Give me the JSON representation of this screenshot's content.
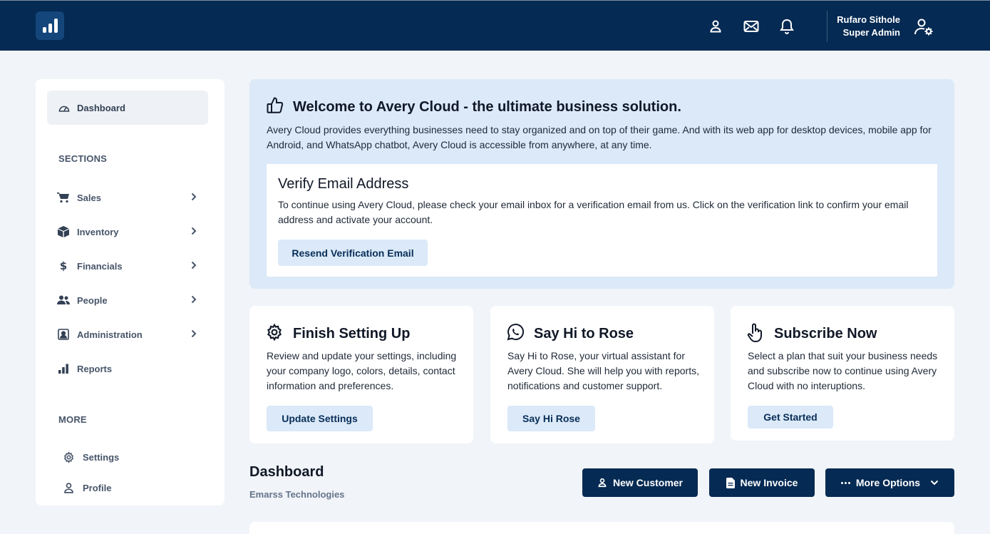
{
  "header": {
    "user_name": "Rufaro Sithole",
    "user_role": "Super Admin"
  },
  "sidebar": {
    "active_item": "Dashboard",
    "sections_heading": "SECTIONS",
    "items": [
      {
        "label": "Sales",
        "icon": "cart-icon"
      },
      {
        "label": "Inventory",
        "icon": "box-icon"
      },
      {
        "label": "Financials",
        "icon": "dollar-icon"
      },
      {
        "label": "People",
        "icon": "users-icon"
      },
      {
        "label": "Administration",
        "icon": "id-badge-icon"
      },
      {
        "label": "Reports",
        "icon": "bar-chart-icon"
      }
    ],
    "more_heading": "MORE",
    "more_items": [
      {
        "label": "Settings",
        "icon": "gear-icon"
      },
      {
        "label": "Profile",
        "icon": "user-icon"
      }
    ]
  },
  "welcome": {
    "title": "Welcome to Avery Cloud - the ultimate business solution.",
    "text": "Avery Cloud provides everything businesses need to stay organized and on top of their game. And with its web app for desktop devices, mobile app for Android, and WhatsApp chatbot, Avery Cloud is accessible from anywhere, at any time."
  },
  "verify": {
    "title": "Verify Email Address",
    "text": "To continue using Avery Cloud, please check your email inbox for a verification email from us. Click on the verification link to confirm your email address and activate your account.",
    "button": "Resend Verification Email"
  },
  "cards": [
    {
      "title": "Finish Setting Up",
      "text": "Review and update your settings, including your company logo, colors, details, contact information and preferences.",
      "button": "Update Settings",
      "icon": "gear-icon"
    },
    {
      "title": "Say Hi to Rose",
      "text": "Say Hi to Rose, your virtual assistant for Avery Cloud. She will help you with reports, notifications and customer support.",
      "button": "Say Hi Rose",
      "icon": "whatsapp-icon"
    },
    {
      "title": "Subscribe Now",
      "text": "Select a plan that suit your business needs and subscribe now to continue using Avery Cloud with no interuptions.",
      "button": "Get Started",
      "icon": "pointer-hand-icon"
    }
  ],
  "dashboard": {
    "title": "Dashboard",
    "company": "Emarss Technologies",
    "buttons": {
      "new_customer": "New Customer",
      "new_invoice": "New Invoice",
      "more_options": "More Options"
    }
  },
  "colors": {
    "navy": "#052a53",
    "light_blue": "#dbe9f8",
    "page_bg": "#f1f4f8"
  }
}
